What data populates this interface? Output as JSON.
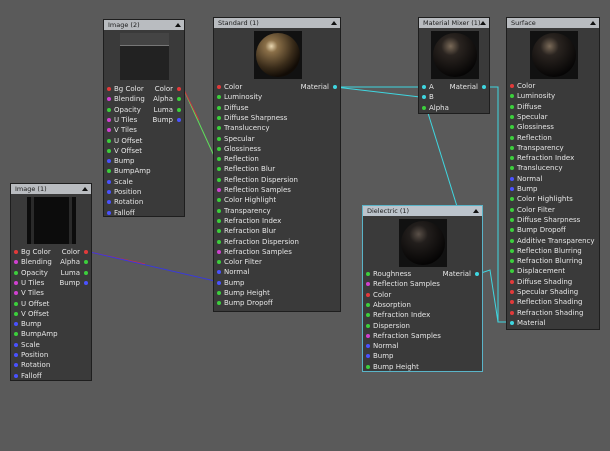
{
  "colors": {
    "background": "#5a5a5a",
    "node_body": "#3a3a3a",
    "node_header": "#b9bcc0",
    "selected_border": "#5ab4c8",
    "wire_cyan": "#3fd6e0",
    "wire_green": "#5fe05a",
    "wire_blue": "#3a3ad8",
    "wire_red": "#c83040",
    "port_colors": {
      "red": "#e23a3a",
      "green": "#3ccf3c",
      "blue": "#4a52ff",
      "magenta": "#d040d0",
      "cyan": "#3fd6e0"
    }
  },
  "nodes": {
    "image2": {
      "title": "Image (2)",
      "inputs": [
        {
          "label": "Bg Color",
          "color": "red"
        },
        {
          "label": "Blending",
          "color": "magenta"
        },
        {
          "label": "Opacity",
          "color": "green"
        },
        {
          "label": "U Tiles",
          "color": "magenta"
        },
        {
          "label": "V Tiles",
          "color": "magenta"
        },
        {
          "label": "U Offset",
          "color": "green"
        },
        {
          "label": "V Offset",
          "color": "green"
        },
        {
          "label": "Bump",
          "color": "blue"
        },
        {
          "label": "BumpAmp",
          "color": "green"
        },
        {
          "label": "Scale",
          "color": "blue"
        },
        {
          "label": "Position",
          "color": "blue"
        },
        {
          "label": "Rotation",
          "color": "blue"
        },
        {
          "label": "Falloff",
          "color": "blue"
        }
      ],
      "outputs": [
        {
          "label": "Color",
          "color": "red"
        },
        {
          "label": "Alpha",
          "color": "green"
        },
        {
          "label": "Luma",
          "color": "green"
        },
        {
          "label": "Bump",
          "color": "blue"
        }
      ]
    },
    "image1": {
      "title": "Image (1)",
      "inputs": [
        {
          "label": "Bg Color",
          "color": "red"
        },
        {
          "label": "Blending",
          "color": "magenta"
        },
        {
          "label": "Opacity",
          "color": "green"
        },
        {
          "label": "U Tiles",
          "color": "magenta"
        },
        {
          "label": "V Tiles",
          "color": "magenta"
        },
        {
          "label": "U Offset",
          "color": "green"
        },
        {
          "label": "V Offset",
          "color": "green"
        },
        {
          "label": "Bump",
          "color": "blue"
        },
        {
          "label": "BumpAmp",
          "color": "green"
        },
        {
          "label": "Scale",
          "color": "blue"
        },
        {
          "label": "Position",
          "color": "blue"
        },
        {
          "label": "Rotation",
          "color": "blue"
        },
        {
          "label": "Falloff",
          "color": "blue"
        }
      ],
      "outputs": [
        {
          "label": "Color",
          "color": "red"
        },
        {
          "label": "Alpha",
          "color": "green"
        },
        {
          "label": "Luma",
          "color": "green"
        },
        {
          "label": "Bump",
          "color": "blue"
        }
      ]
    },
    "standard": {
      "title": "Standard (1)",
      "inputs": [
        {
          "label": "Color",
          "color": "red"
        },
        {
          "label": "Luminosity",
          "color": "green"
        },
        {
          "label": "Diffuse",
          "color": "green"
        },
        {
          "label": "Diffuse Sharpness",
          "color": "green"
        },
        {
          "label": "Translucency",
          "color": "green"
        },
        {
          "label": "Specular",
          "color": "green"
        },
        {
          "label": "Glossiness",
          "color": "green"
        },
        {
          "label": "Reflection",
          "color": "green"
        },
        {
          "label": "Reflection Blur",
          "color": "green"
        },
        {
          "label": "Reflection Dispersion",
          "color": "green"
        },
        {
          "label": "Reflection Samples",
          "color": "magenta"
        },
        {
          "label": "Color Highlight",
          "color": "green"
        },
        {
          "label": "Transparency",
          "color": "green"
        },
        {
          "label": "Refraction Index",
          "color": "green"
        },
        {
          "label": "Refraction Blur",
          "color": "green"
        },
        {
          "label": "Refraction Dispersion",
          "color": "green"
        },
        {
          "label": "Refraction Samples",
          "color": "magenta"
        },
        {
          "label": "Color Filter",
          "color": "green"
        },
        {
          "label": "Normal",
          "color": "blue"
        },
        {
          "label": "Bump",
          "color": "blue"
        },
        {
          "label": "Bump Height",
          "color": "green"
        },
        {
          "label": "Bump Dropoff",
          "color": "green"
        }
      ],
      "outputs": [
        {
          "label": "Material",
          "color": "cyan"
        }
      ]
    },
    "mixer": {
      "title": "Material Mixer (1)",
      "inputs": [
        {
          "label": "A",
          "color": "cyan"
        },
        {
          "label": "B",
          "color": "cyan"
        },
        {
          "label": "Alpha",
          "color": "green"
        }
      ],
      "outputs": [
        {
          "label": "Material",
          "color": "cyan"
        }
      ]
    },
    "dielectric": {
      "title": "Dielectric (1)",
      "inputs": [
        {
          "label": "Roughness",
          "color": "green"
        },
        {
          "label": "Reflection Samples",
          "color": "magenta"
        },
        {
          "label": "Color",
          "color": "red"
        },
        {
          "label": "Absorption",
          "color": "green"
        },
        {
          "label": "Refraction Index",
          "color": "green"
        },
        {
          "label": "Dispersion",
          "color": "green"
        },
        {
          "label": "Refraction Samples",
          "color": "magenta"
        },
        {
          "label": "Normal",
          "color": "blue"
        },
        {
          "label": "Bump",
          "color": "blue"
        },
        {
          "label": "Bump Height",
          "color": "green"
        }
      ],
      "outputs": [
        {
          "label": "Material",
          "color": "cyan"
        }
      ]
    },
    "surface": {
      "title": "Surface",
      "inputs": [
        {
          "label": "Color",
          "color": "red"
        },
        {
          "label": "Luminosity",
          "color": "green"
        },
        {
          "label": "Diffuse",
          "color": "green"
        },
        {
          "label": "Specular",
          "color": "green"
        },
        {
          "label": "Glossiness",
          "color": "green"
        },
        {
          "label": "Reflection",
          "color": "green"
        },
        {
          "label": "Transparency",
          "color": "green"
        },
        {
          "label": "Refraction Index",
          "color": "green"
        },
        {
          "label": "Translucency",
          "color": "green"
        },
        {
          "label": "Normal",
          "color": "blue"
        },
        {
          "label": "Bump",
          "color": "blue"
        },
        {
          "label": "Color Highlights",
          "color": "green"
        },
        {
          "label": "Color Filter",
          "color": "green"
        },
        {
          "label": "Diffuse Sharpness",
          "color": "green"
        },
        {
          "label": "Bump Dropoff",
          "color": "green"
        },
        {
          "label": "Additive Transparency",
          "color": "green"
        },
        {
          "label": "Reflection Blurring",
          "color": "green"
        },
        {
          "label": "Refraction Blurring",
          "color": "green"
        },
        {
          "label": "Displacement",
          "color": "green"
        },
        {
          "label": "Diffuse Shading",
          "color": "red"
        },
        {
          "label": "Specular Shading",
          "color": "red"
        },
        {
          "label": "Reflection Shading",
          "color": "red"
        },
        {
          "label": "Refraction Shading",
          "color": "red"
        },
        {
          "label": "Material",
          "color": "cyan"
        }
      ],
      "outputs": []
    }
  }
}
